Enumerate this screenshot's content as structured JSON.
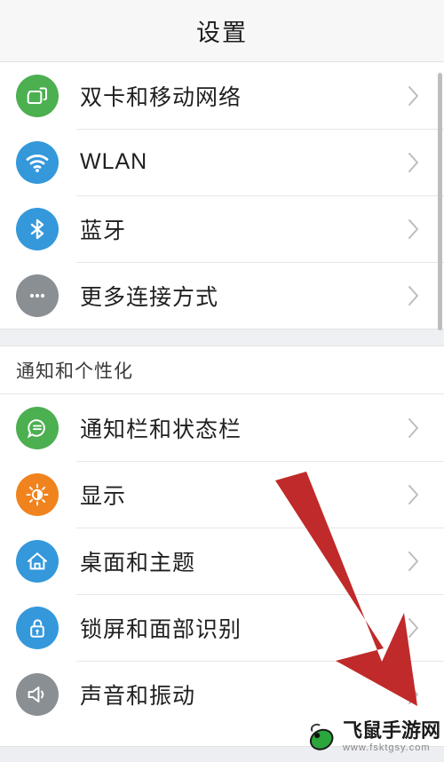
{
  "header": {
    "title": "设置"
  },
  "colors": {
    "icon_green": "#4CAF50",
    "icon_blue": "#3498db",
    "icon_gray": "#8a8f94",
    "icon_orange": "#f0831e",
    "arrow_red": "#c02a2a",
    "titlebar_bg": "#f7f7f7",
    "separator_bg": "#eef0f3",
    "divider": "#e6e6e6",
    "chevron": "#bdbdbd",
    "text_primary": "#1f1f1f",
    "watermark_green": "#2aa63c"
  },
  "sections": [
    {
      "name": "connectivity",
      "header": null,
      "items": [
        {
          "key": "dual-sim-mobile-network",
          "label": "双卡和移动网络",
          "icon": "sim-cards-icon",
          "icon_color": "#4CAF50"
        },
        {
          "key": "wlan",
          "label": "WLAN",
          "icon": "wifi-icon",
          "icon_color": "#3498db"
        },
        {
          "key": "bluetooth",
          "label": "蓝牙",
          "icon": "bluetooth-icon",
          "icon_color": "#3498db"
        },
        {
          "key": "more-connections",
          "label": "更多连接方式",
          "icon": "more-dots-icon",
          "icon_color": "#8a8f94"
        }
      ]
    },
    {
      "name": "notifications-personalization",
      "header": "通知和个性化",
      "items": [
        {
          "key": "notification-status-bar",
          "label": "通知栏和状态栏",
          "icon": "chat-bubble-icon",
          "icon_color": "#4CAF50"
        },
        {
          "key": "display",
          "label": "显示",
          "icon": "brightness-sun-icon",
          "icon_color": "#f0831e"
        },
        {
          "key": "home-screen-themes",
          "label": "桌面和主题",
          "icon": "home-icon",
          "icon_color": "#3498db"
        },
        {
          "key": "lockscreen-face-unlock",
          "label": "锁屏和面部识别",
          "icon": "unlocked-padlock-icon",
          "icon_color": "#3498db"
        },
        {
          "key": "sound-vibration",
          "label": "声音和振动",
          "icon": "speaker-icon",
          "icon_color": "#8a8f94"
        }
      ]
    }
  ],
  "annotation": {
    "arrow": {
      "name": "red-pointer-arrow",
      "color": "#c02a2a",
      "points_to": "sound-vibration"
    }
  },
  "watermark": {
    "site_name": "飞鼠手游网",
    "url": "www.fsktgsy.com",
    "logo": "mouse-logo"
  }
}
